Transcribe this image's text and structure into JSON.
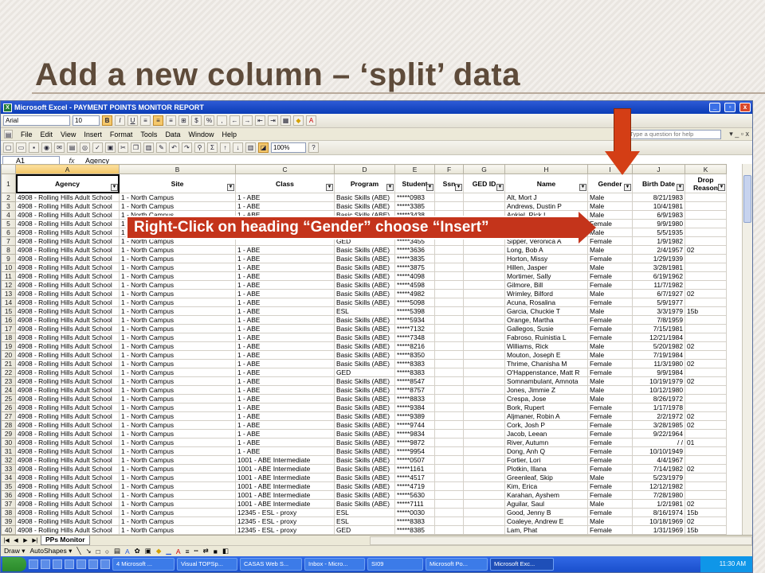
{
  "slide": {
    "title": "Add a new column – ‘split’ data",
    "callout": "Right-Click  on heading “Gender” choose “Insert”",
    "accent": "#c4341b"
  },
  "window": {
    "title": "Microsoft Excel - PAYMENT POINTS MONITOR REPORT",
    "minimize": "_",
    "restore": "▫",
    "close": "x"
  },
  "format_toolbar": {
    "font": "Arial",
    "size": "10",
    "bold": "B",
    "italic": "I",
    "underline": "U",
    "currency": "$",
    "percent": "%"
  },
  "menu": {
    "items": [
      "File",
      "Edit",
      "View",
      "Insert",
      "Format",
      "Tools",
      "Data",
      "Window",
      "Help"
    ],
    "help_placeholder": "Type a question for help",
    "window_ctl": "▾ _ ▫ x"
  },
  "standard_toolbar": {
    "zoom": "100%",
    "sigma": "Σ"
  },
  "formula_bar": {
    "name_box": "A1",
    "fx": "fx",
    "content": "Agency"
  },
  "columns": [
    "A",
    "B",
    "C",
    "D",
    "E",
    "F",
    "G",
    "H",
    "I",
    "J",
    "K"
  ],
  "headers": [
    "Agency",
    "Site",
    "Class",
    "Program",
    "Student",
    "Ssn",
    "GED ID",
    "Name",
    "Gender",
    "Birth Date",
    "Drop Reason"
  ],
  "rows": [
    {
      "n": "2",
      "c": [
        "4908 - Rolling Hills Adult School",
        "1 - North Campus",
        "1 - ABE",
        "Basic Skills (ABE)",
        "*****0983",
        "",
        "",
        "Alt, Mort J",
        "Male",
        "8/21/1983",
        ""
      ]
    },
    {
      "n": "3",
      "c": [
        "4908 - Rolling Hills Adult School",
        "1 - North Campus",
        "1 - ABE",
        "Basic Skills (ABE)",
        "*****3385",
        "",
        "",
        "Andrews, Dustin P",
        "Male",
        "10/4/1981",
        ""
      ]
    },
    {
      "n": "4",
      "c": [
        "4908 - Rolling Hills Adult School",
        "1 - North Campus",
        "1 - ABE",
        "Basic Skills (ABE)",
        "*****3438",
        "",
        "",
        "Ankiel, Rick L",
        "Male",
        "6/9/1983",
        ""
      ]
    },
    {
      "n": "5",
      "c": [
        "4908 - Rolling Hills Adult School",
        "1 -",
        "",
        "",
        "",
        "",
        "",
        "",
        "Female",
        "9/9/1980",
        ""
      ]
    },
    {
      "n": "6",
      "c": [
        "4908 - Rolling Hills Adult School",
        "1 -",
        "",
        "",
        "",
        "",
        "",
        "",
        "Male",
        "5/5/1935",
        ""
      ]
    },
    {
      "n": "7",
      "c": [
        "4908 - Rolling Hills Adult School",
        "1 - North Campus",
        "",
        "GED",
        "*****3455",
        "",
        "",
        "Sipper, Veronica A",
        "Female",
        "1/9/1982",
        ""
      ]
    },
    {
      "n": "8",
      "c": [
        "4908 - Rolling Hills Adult School",
        "1 - North Campus",
        "1 - ABE",
        "Basic Skills (ABE)",
        "*****3636",
        "",
        "",
        "Long, Bob A",
        "Male",
        "2/4/1957",
        "02"
      ]
    },
    {
      "n": "9",
      "c": [
        "4908 - Rolling Hills Adult School",
        "1 - North Campus",
        "1 - ABE",
        "Basic Skills (ABE)",
        "*****3835",
        "",
        "",
        "Horton, Missy",
        "Female",
        "1/29/1939",
        ""
      ]
    },
    {
      "n": "10",
      "c": [
        "4908 - Rolling Hills Adult School",
        "1 - North Campus",
        "1 - ABE",
        "Basic Skills (ABE)",
        "*****3875",
        "",
        "",
        "Hillen, Jasper",
        "Male",
        "3/28/1981",
        ""
      ]
    },
    {
      "n": "11",
      "c": [
        "4908 - Rolling Hills Adult School",
        "1 - North Campus",
        "1 - ABE",
        "Basic Skills (ABE)",
        "*****4098",
        "",
        "",
        "Mortimer, Sally",
        "Female",
        "6/19/1962",
        ""
      ]
    },
    {
      "n": "12",
      "c": [
        "4908 - Rolling Hills Adult School",
        "1 - North Campus",
        "1 - ABE",
        "Basic Skills (ABE)",
        "*****4598",
        "",
        "",
        "Gilmore, Bill",
        "Female",
        "11/7/1982",
        ""
      ]
    },
    {
      "n": "13",
      "c": [
        "4908 - Rolling Hills Adult School",
        "1 - North Campus",
        "1 - ABE",
        "Basic Skills (ABE)",
        "*****4982",
        "",
        "",
        "Wrimley, Bilford",
        "Male",
        "6/7/1927",
        "02"
      ]
    },
    {
      "n": "14",
      "c": [
        "4908 - Rolling Hills Adult School",
        "1 - North Campus",
        "1 - ABE",
        "Basic Skills (ABE)",
        "*****5098",
        "",
        "",
        "Acuna, Rosalina",
        "Female",
        "5/9/1977",
        ""
      ]
    },
    {
      "n": "15",
      "c": [
        "4908 - Rolling Hills Adult School",
        "1 - North Campus",
        "1 - ABE",
        "ESL",
        "*****5398",
        "",
        "",
        "Garcia, Chuckie T",
        "Male",
        "3/3/1979",
        "15b"
      ]
    },
    {
      "n": "16",
      "c": [
        "4908 - Rolling Hills Adult School",
        "1 - North Campus",
        "1 - ABE",
        "Basic Skills (ABE)",
        "*****5934",
        "",
        "",
        "Orange, Martha",
        "Female",
        "7/8/1959",
        ""
      ]
    },
    {
      "n": "17",
      "c": [
        "4908 - Rolling Hills Adult School",
        "1 - North Campus",
        "1 - ABE",
        "Basic Skills (ABE)",
        "*****7132",
        "",
        "",
        "Gallegos, Susie",
        "Female",
        "7/15/1981",
        ""
      ]
    },
    {
      "n": "18",
      "c": [
        "4908 - Rolling Hills Adult School",
        "1 - North Campus",
        "1 - ABE",
        "Basic Skills (ABE)",
        "*****7348",
        "",
        "",
        "Fabroso, Ruinistia L",
        "Female",
        "12/21/1984",
        ""
      ]
    },
    {
      "n": "19",
      "c": [
        "4908 - Rolling Hills Adult School",
        "1 - North Campus",
        "1 - ABE",
        "Basic Skills (ABE)",
        "*****8216",
        "",
        "",
        "Williams, Rick",
        "Male",
        "5/20/1982",
        "02"
      ]
    },
    {
      "n": "20",
      "c": [
        "4908 - Rolling Hills Adult School",
        "1 - North Campus",
        "1 - ABE",
        "Basic Skills (ABE)",
        "*****8350",
        "",
        "",
        "Mouton, Joseph E",
        "Male",
        "7/19/1984",
        ""
      ]
    },
    {
      "n": "21",
      "c": [
        "4908 - Rolling Hills Adult School",
        "1 - North Campus",
        "1 - ABE",
        "Basic Skills (ABE)",
        "*****8383",
        "",
        "",
        "Thrime, Chanisha M",
        "Female",
        "11/3/1980",
        "02"
      ]
    },
    {
      "n": "22",
      "c": [
        "4908 - Rolling Hills Adult School",
        "1 - North Campus",
        "1 - ABE",
        "GED",
        "*****8383",
        "",
        "",
        "O'Happenstance, Matt R",
        "Female",
        "9/9/1984",
        ""
      ]
    },
    {
      "n": "23",
      "c": [
        "4908 - Rolling Hills Adult School",
        "1 - North Campus",
        "1 - ABE",
        "Basic Skills (ABE)",
        "*****8547",
        "",
        "",
        "Somnambulant, Amnota",
        "Male",
        "10/19/1979",
        "02"
      ]
    },
    {
      "n": "24",
      "c": [
        "4908 - Rolling Hills Adult School",
        "1 - North Campus",
        "1 - ABE",
        "Basic Skills (ABE)",
        "*****8757",
        "",
        "",
        "Jones, Jimmie Z",
        "Male",
        "10/12/1980",
        ""
      ]
    },
    {
      "n": "25",
      "c": [
        "4908 - Rolling Hills Adult School",
        "1 - North Campus",
        "1 - ABE",
        "Basic Skills (ABE)",
        "*****8833",
        "",
        "",
        "Crespa, Jose",
        "Male",
        "8/26/1972",
        ""
      ]
    },
    {
      "n": "26",
      "c": [
        "4908 - Rolling Hills Adult School",
        "1 - North Campus",
        "1 - ABE",
        "Basic Skills (ABE)",
        "*****9384",
        "",
        "",
        "Bork, Rupert",
        "Female",
        "1/17/1978",
        ""
      ]
    },
    {
      "n": "27",
      "c": [
        "4908 - Rolling Hills Adult School",
        "1 - North Campus",
        "1 - ABE",
        "Basic Skills (ABE)",
        "*****9389",
        "",
        "",
        "Aljmaner, Robin A",
        "Female",
        "2/2/1972",
        "02"
      ]
    },
    {
      "n": "28",
      "c": [
        "4908 - Rolling Hills Adult School",
        "1 - North Campus",
        "1 - ABE",
        "Basic Skills (ABE)",
        "*****9744",
        "",
        "",
        "Cork, Josh P",
        "Female",
        "3/28/1985",
        "02"
      ]
    },
    {
      "n": "29",
      "c": [
        "4908 - Rolling Hills Adult School",
        "1 - North Campus",
        "1 - ABE",
        "Basic Skills (ABE)",
        "*****9834",
        "",
        "",
        "Jacob, Leean",
        "Female",
        "9/22/1964",
        ""
      ]
    },
    {
      "n": "30",
      "c": [
        "4908 - Rolling Hills Adult School",
        "1 - North Campus",
        "1 - ABE",
        "Basic Skills (ABE)",
        "*****9872",
        "",
        "",
        "River, Autumn",
        "Female",
        "/  /",
        "01"
      ]
    },
    {
      "n": "31",
      "c": [
        "4908 - Rolling Hills Adult School",
        "1 - North Campus",
        "1 - ABE",
        "Basic Skills (ABE)",
        "*****9954",
        "",
        "",
        "Dong, Anh Q",
        "Female",
        "10/10/1949",
        ""
      ]
    },
    {
      "n": "32",
      "c": [
        "4908 - Rolling Hills Adult School",
        "1 - North Campus",
        "1001 - ABE Intermediate",
        "Basic Skills (ABE)",
        "*****0507",
        "",
        "",
        "Fortier, Lori",
        "Female",
        "4/4/1967",
        ""
      ]
    },
    {
      "n": "33",
      "c": [
        "4908 - Rolling Hills Adult School",
        "1 - North Campus",
        "1001 - ABE Intermediate",
        "Basic Skills (ABE)",
        "*****1161",
        "",
        "",
        "Plotkin, Illana",
        "Female",
        "7/14/1982",
        "02"
      ]
    },
    {
      "n": "34",
      "c": [
        "4908 - Rolling Hills Adult School",
        "1 - North Campus",
        "1001 - ABE Intermediate",
        "Basic Skills (ABE)",
        "*****4517",
        "",
        "",
        "Greenleaf, Skip",
        "Male",
        "5/23/1979",
        ""
      ]
    },
    {
      "n": "35",
      "c": [
        "4908 - Rolling Hills Adult School",
        "1 - North Campus",
        "1001 - ABE Intermediate",
        "Basic Skills (ABE)",
        "*****4719",
        "",
        "",
        "Kim, Erica",
        "Female",
        "12/12/1982",
        ""
      ]
    },
    {
      "n": "36",
      "c": [
        "4908 - Rolling Hills Adult School",
        "1 - North Campus",
        "1001 - ABE Intermediate",
        "Basic Skills (ABE)",
        "*****5630",
        "",
        "",
        "Karahan, Ayshem",
        "Female",
        "7/28/1980",
        ""
      ]
    },
    {
      "n": "37",
      "c": [
        "4908 - Rolling Hills Adult School",
        "1 - North Campus",
        "1001 - ABE Intermediate",
        "Basic Skills (ABE)",
        "*****7111",
        "",
        "",
        "Aguilar, Saul",
        "Male",
        "1/2/1981",
        "02"
      ]
    },
    {
      "n": "38",
      "c": [
        "4908 - Rolling Hills Adult School",
        "1 - North Campus",
        "12345 - ESL - proxy",
        "ESL",
        "*****0030",
        "",
        "",
        "Good, Jenny B",
        "Female",
        "8/16/1974",
        "15b"
      ]
    },
    {
      "n": "39",
      "c": [
        "4908 - Rolling Hills Adult School",
        "1 - North Campus",
        "12345 - ESL - proxy",
        "ESL",
        "*****8383",
        "",
        "",
        "Coaleye, Andrew E",
        "Male",
        "10/18/1969",
        "02"
      ]
    },
    {
      "n": "40",
      "c": [
        "4908 - Rolling Hills Adult School",
        "1 - North Campus",
        "12345 - ESL - proxy",
        "GED",
        "*****8385",
        "",
        "",
        "Lam, Phat",
        "Female",
        "1/31/1969",
        "15b"
      ]
    }
  ],
  "sheet_tab": "PPs Monitor",
  "drawbar": {
    "draw": "Draw ▾",
    "autoshapes": "AutoShapes ▾"
  },
  "taskbar": {
    "tasks": [
      "4 Microsoft ...",
      "Visual TOPSp...",
      "CASAS Web S...",
      "Inbox - Micro...",
      "SI09",
      "Microsoft Po...",
      "Microsoft Exc..."
    ],
    "clock": "11:30 AM"
  }
}
